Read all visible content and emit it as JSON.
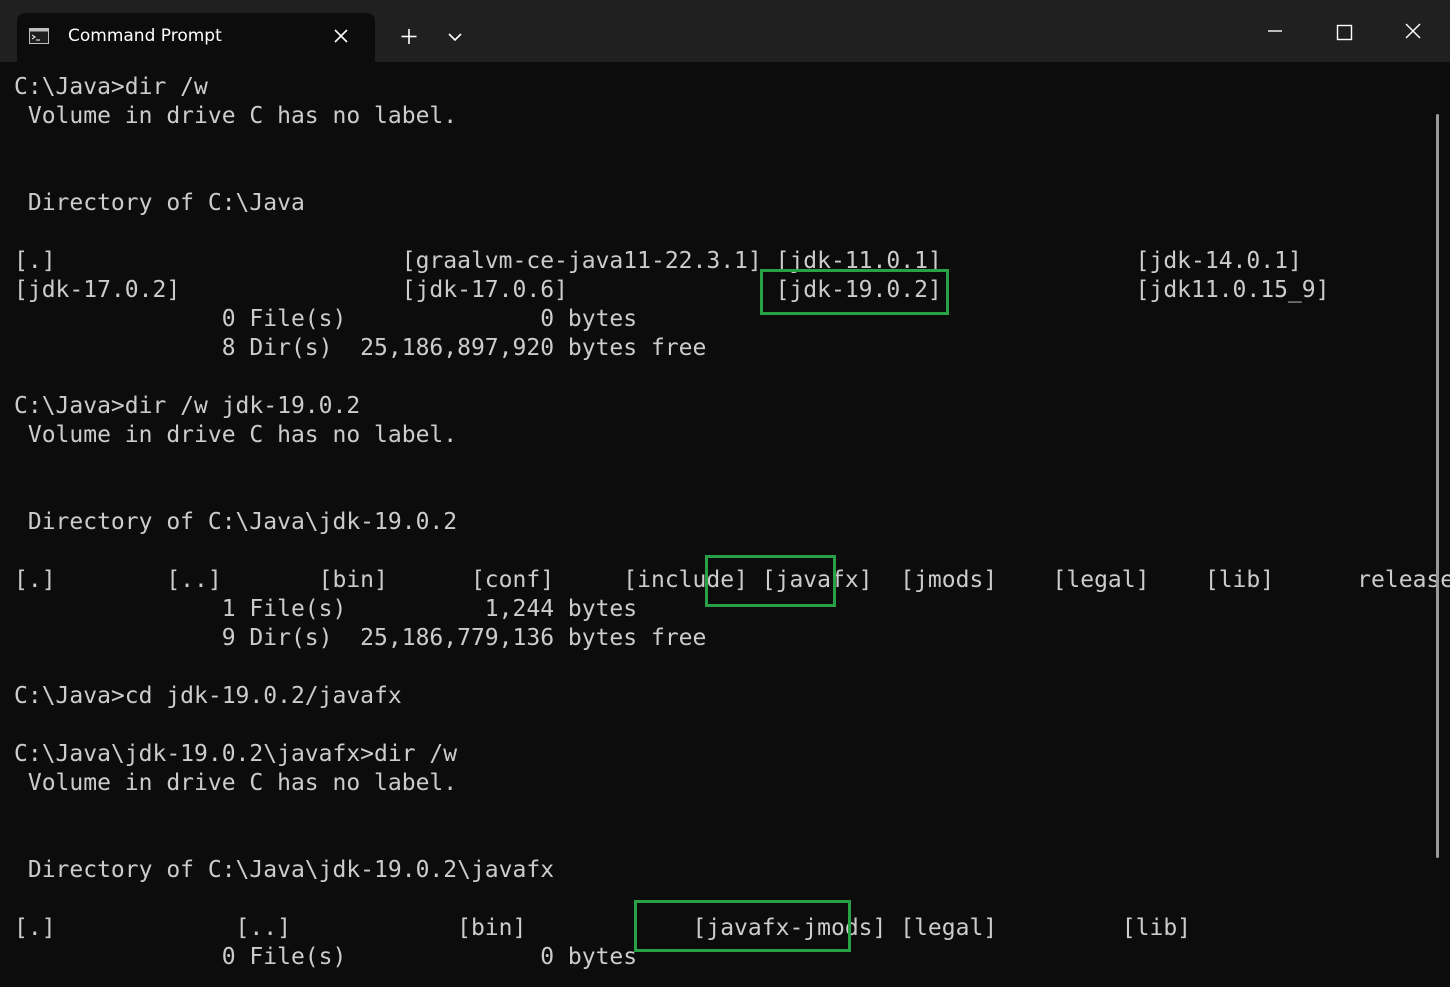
{
  "window": {
    "tab_title": "Command Prompt",
    "icons": {
      "tab": "terminal-app-icon",
      "tab_close": "close-icon",
      "new_tab": "plus-icon",
      "dropdown": "chevron-down-icon",
      "minimize": "minimize-icon",
      "maximize": "maximize-icon",
      "close": "close-icon"
    }
  },
  "terminal": {
    "lines": [
      "C:\\Java>dir /w",
      " Volume in drive C has no label.",
      "",
      "",
      " Directory of C:\\Java",
      "",
      "[.]                         [graalvm-ce-java11-22.3.1] [jdk-11.0.1]              [jdk-14.0.1]",
      "[jdk-17.0.2]                [jdk-17.0.6]               [jdk-19.0.2]              [jdk11.0.15_9]",
      "               0 File(s)              0 bytes",
      "               8 Dir(s)  25,186,897,920 bytes free",
      "",
      "C:\\Java>dir /w jdk-19.0.2",
      " Volume in drive C has no label.",
      "",
      "",
      " Directory of C:\\Java\\jdk-19.0.2",
      "",
      "[.]        [..]       [bin]      [conf]     [include] [javafx]  [jmods]    [legal]    [lib]      release",
      "               1 File(s)          1,244 bytes",
      "               9 Dir(s)  25,186,779,136 bytes free",
      "",
      "C:\\Java>cd jdk-19.0.2/javafx",
      "",
      "C:\\Java\\jdk-19.0.2\\javafx>dir /w",
      " Volume in drive C has no label.",
      "",
      "",
      " Directory of C:\\Java\\jdk-19.0.2\\javafx",
      "",
      "[.]             [..]            [bin]            [javafx-jmods] [legal]         [lib]",
      "               0 File(s)              0 bytes"
    ]
  },
  "colors": {
    "terminal_bg": "#0c0c0c",
    "titlebar_bg": "#202020",
    "text": "#cccccc",
    "highlight": "#27a046"
  }
}
